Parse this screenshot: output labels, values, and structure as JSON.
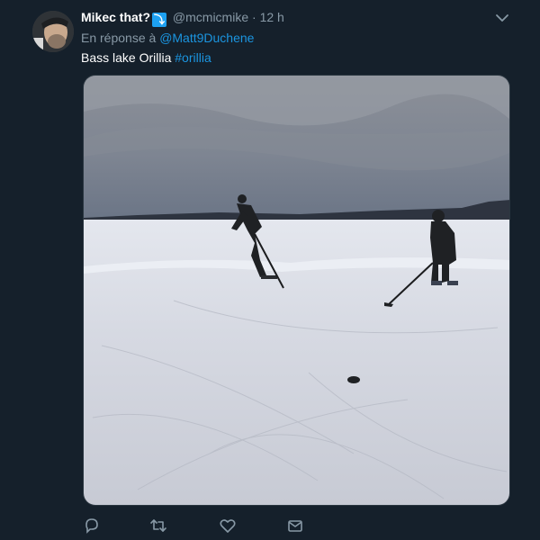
{
  "tweet": {
    "display_name": "Mikec that?",
    "verified_badge": "⤵",
    "handle": "@mcmicmike",
    "separator": "·",
    "time": "12 h",
    "reply_prefix": "En réponse à",
    "reply_to": "@Matt9Duchene",
    "text": "Bass lake Orillia",
    "hashtag": "#orillia"
  },
  "icons": {
    "more": "chevron-down-icon",
    "reply": "reply-icon",
    "retweet": "retweet-icon",
    "like": "heart-icon",
    "share": "mail-icon"
  },
  "colors": {
    "background": "#15202b",
    "secondary_text": "#8899a6",
    "link": "#1b95e0"
  }
}
